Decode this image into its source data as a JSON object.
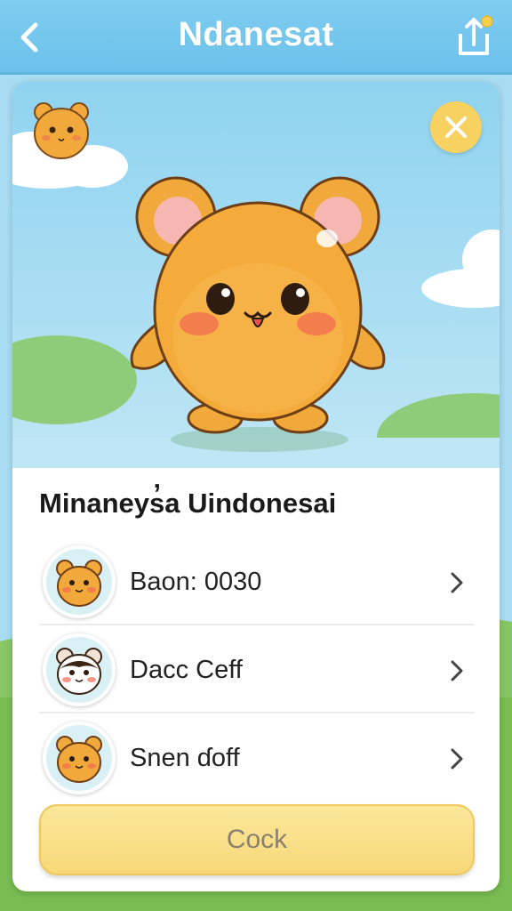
{
  "header": {
    "title": "Ndanesat",
    "back_icon": "chevron-left-icon",
    "share_icon": "share-icon"
  },
  "colors": {
    "header": "#6cc1ea",
    "sky": "#a9dcf2",
    "grass": "#6fb64a",
    "character": "#f2a93b",
    "button": "#f7d878",
    "close_button": "#f7d261"
  },
  "card": {
    "section_title": "Minaneys̓a Uindonesai",
    "items": [
      {
        "label": "Baon: 0030",
        "avatar": "orange-hamster-avatar"
      },
      {
        "label": "Dacc Ceff",
        "avatar": "panda-hamster-avatar"
      },
      {
        "label": "Snen ɗoff",
        "avatar": "orange-hamster-avatar"
      }
    ],
    "primary_button": "Cock"
  }
}
